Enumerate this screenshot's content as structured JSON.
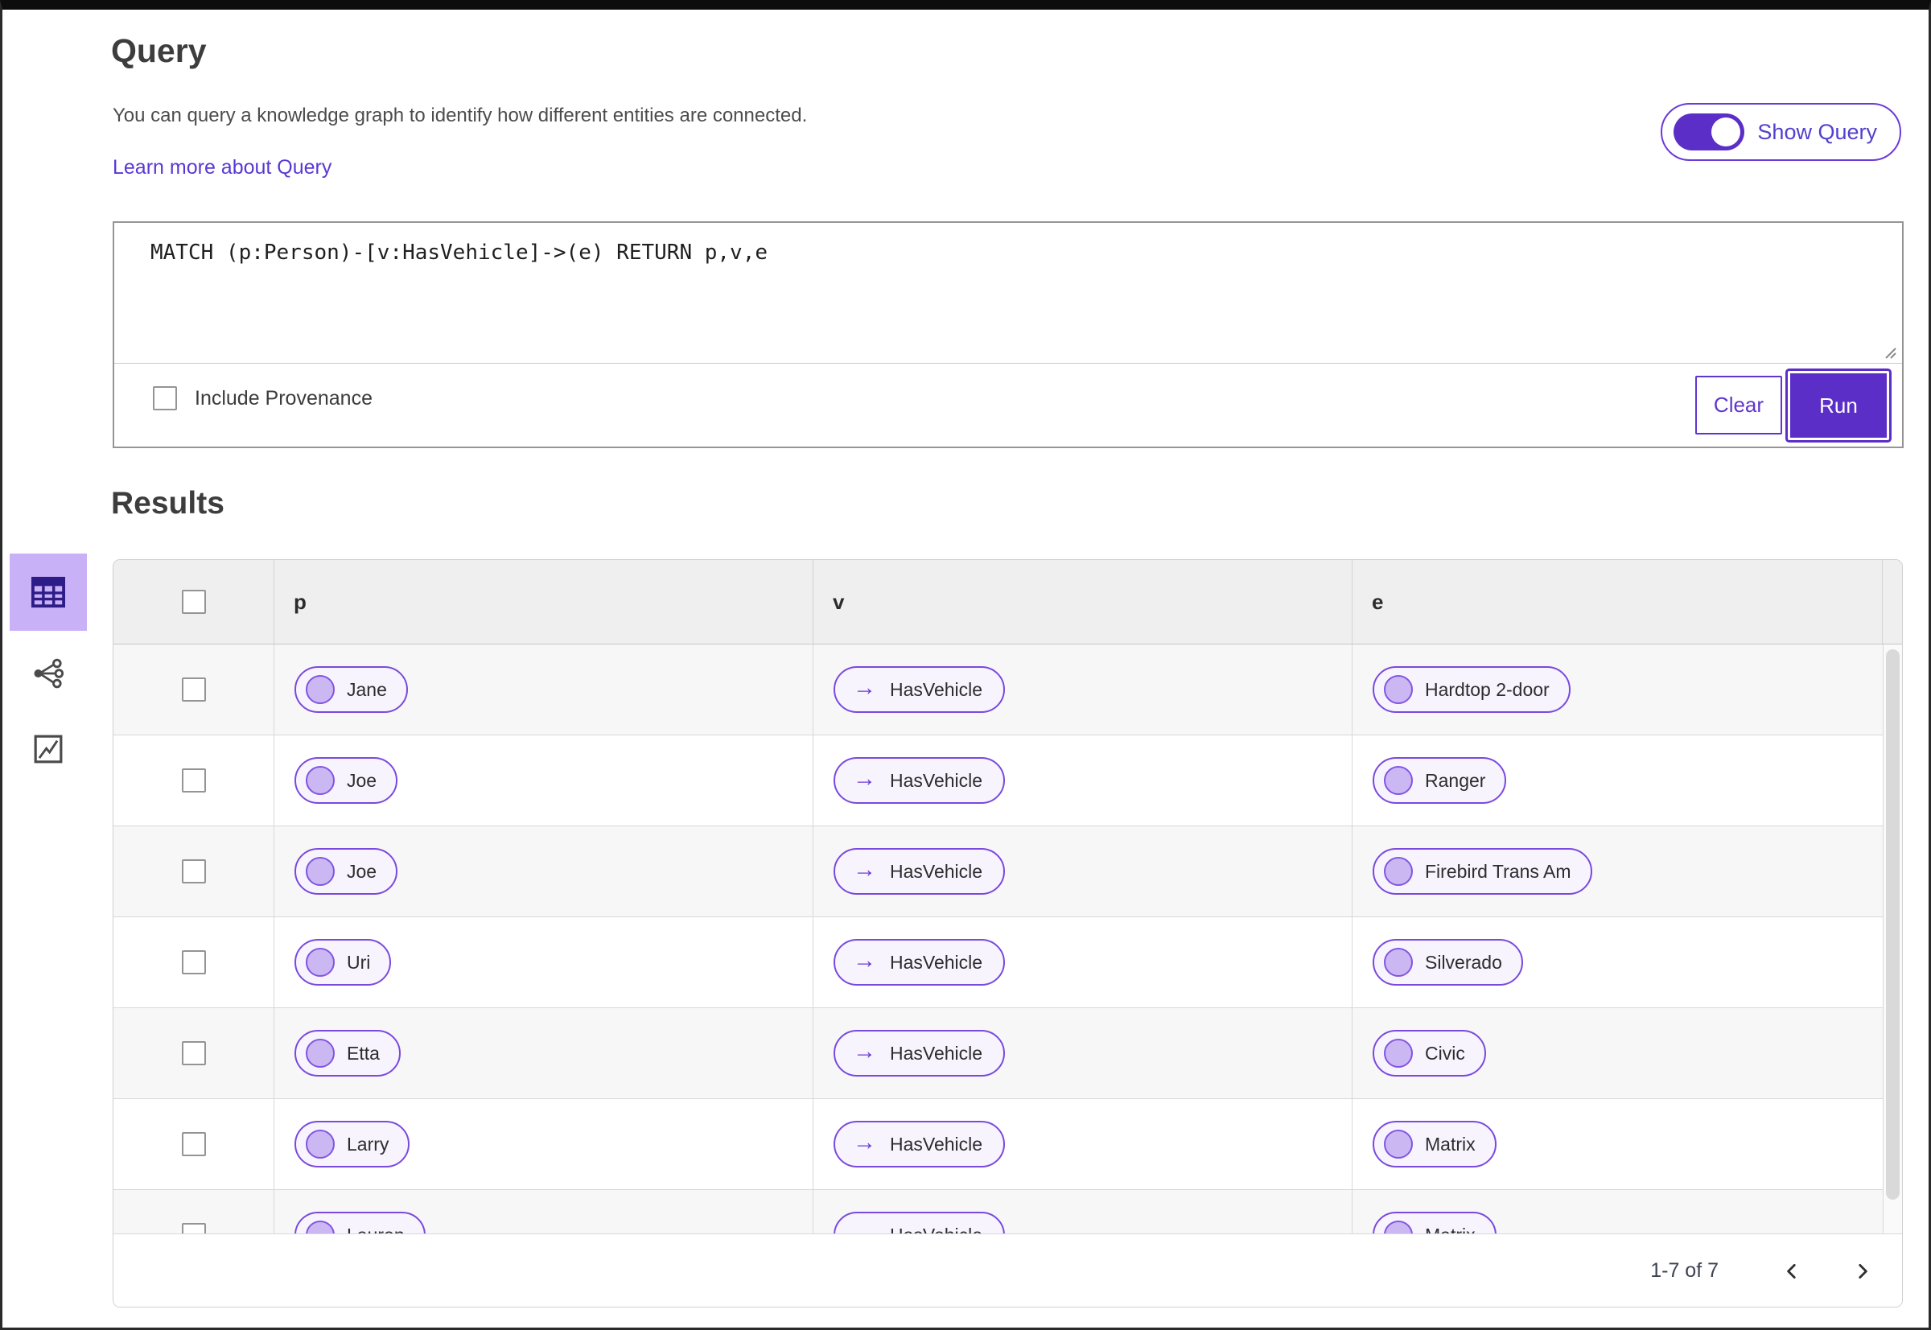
{
  "query": {
    "title": "Query",
    "description": "You can query a knowledge graph to identify how different entities are connected.",
    "learn_more": "Learn more about Query",
    "show_query_label": "Show Query",
    "show_query_on": true,
    "editor_text": "MATCH (p:Person)-[v:HasVehicle]->(e) RETURN p,v,e",
    "include_provenance_label": "Include Provenance",
    "include_provenance_checked": false,
    "clear_label": "Clear",
    "run_label": "Run"
  },
  "results": {
    "title": "Results",
    "view_modes": [
      "table",
      "graph",
      "chart"
    ],
    "selected_view": "table",
    "table": {
      "columns": [
        "p",
        "v",
        "e"
      ],
      "edge_arrow": "→",
      "rows": [
        {
          "p": "Jane",
          "v": "HasVehicle",
          "e": "Hardtop 2-door"
        },
        {
          "p": "Joe",
          "v": "HasVehicle",
          "e": "Ranger"
        },
        {
          "p": "Joe",
          "v": "HasVehicle",
          "e": "Firebird Trans Am"
        },
        {
          "p": "Uri",
          "v": "HasVehicle",
          "e": "Silverado"
        },
        {
          "p": "Etta",
          "v": "HasVehicle",
          "e": "Civic"
        },
        {
          "p": "Larry",
          "v": "HasVehicle",
          "e": "Matrix"
        },
        {
          "p": "Lauren",
          "v": "HasVehicle",
          "e": "Matrix"
        }
      ]
    },
    "pagination": {
      "range_label": "1-7 of 7"
    }
  },
  "colors": {
    "primary_purple": "#5b2ec8",
    "pill_border": "#7a49dd",
    "pill_background": "#f7f4fe",
    "node_dot_fill": "#cbb8f3",
    "selected_view_background": "#c9b1f7",
    "link": "#5a38d4",
    "header_row_background": "#efefef",
    "striped_row_background": "#f7f7f7"
  }
}
